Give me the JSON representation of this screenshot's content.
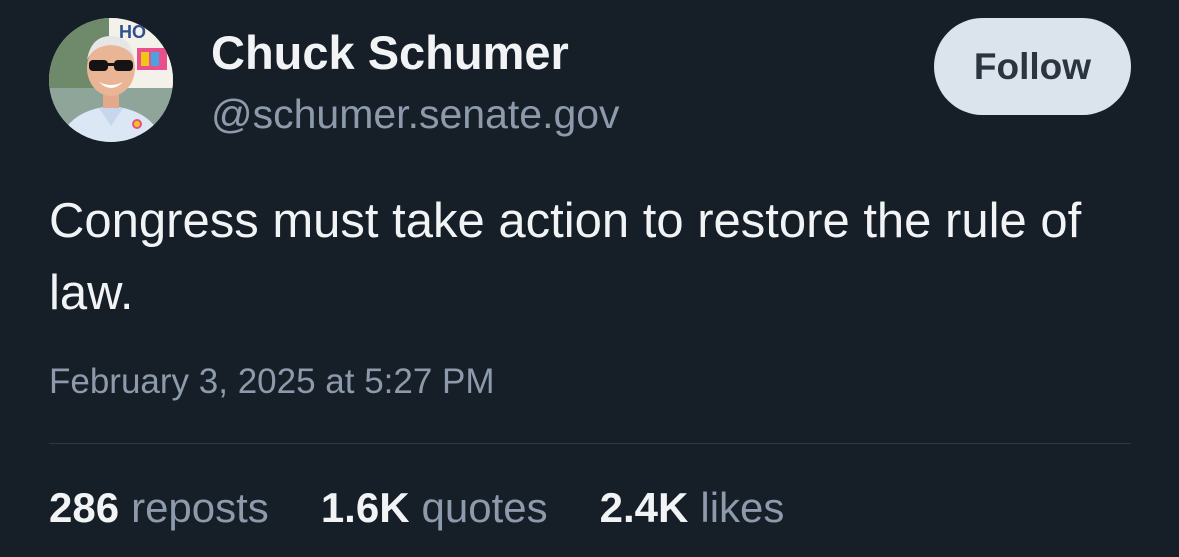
{
  "author": {
    "display_name": "Chuck Schumer",
    "handle": "@schumer.senate.gov"
  },
  "follow_button": {
    "label": "Follow"
  },
  "post": {
    "text": "Congress must take action to restore the rule of law.",
    "timestamp": "February 3, 2025 at 5:27 PM"
  },
  "stats": [
    {
      "count": "286",
      "label": "reposts"
    },
    {
      "count": "1.6K",
      "label": "quotes"
    },
    {
      "count": "2.4K",
      "label": "likes"
    }
  ],
  "avatar_sign_text": "HO",
  "colors": {
    "background": "#161e27",
    "text_primary": "#f1f3f5",
    "text_secondary": "#8d9aab",
    "button_bg": "#dbe3ec",
    "button_text": "#2b3540",
    "divider": "#2d3844"
  }
}
